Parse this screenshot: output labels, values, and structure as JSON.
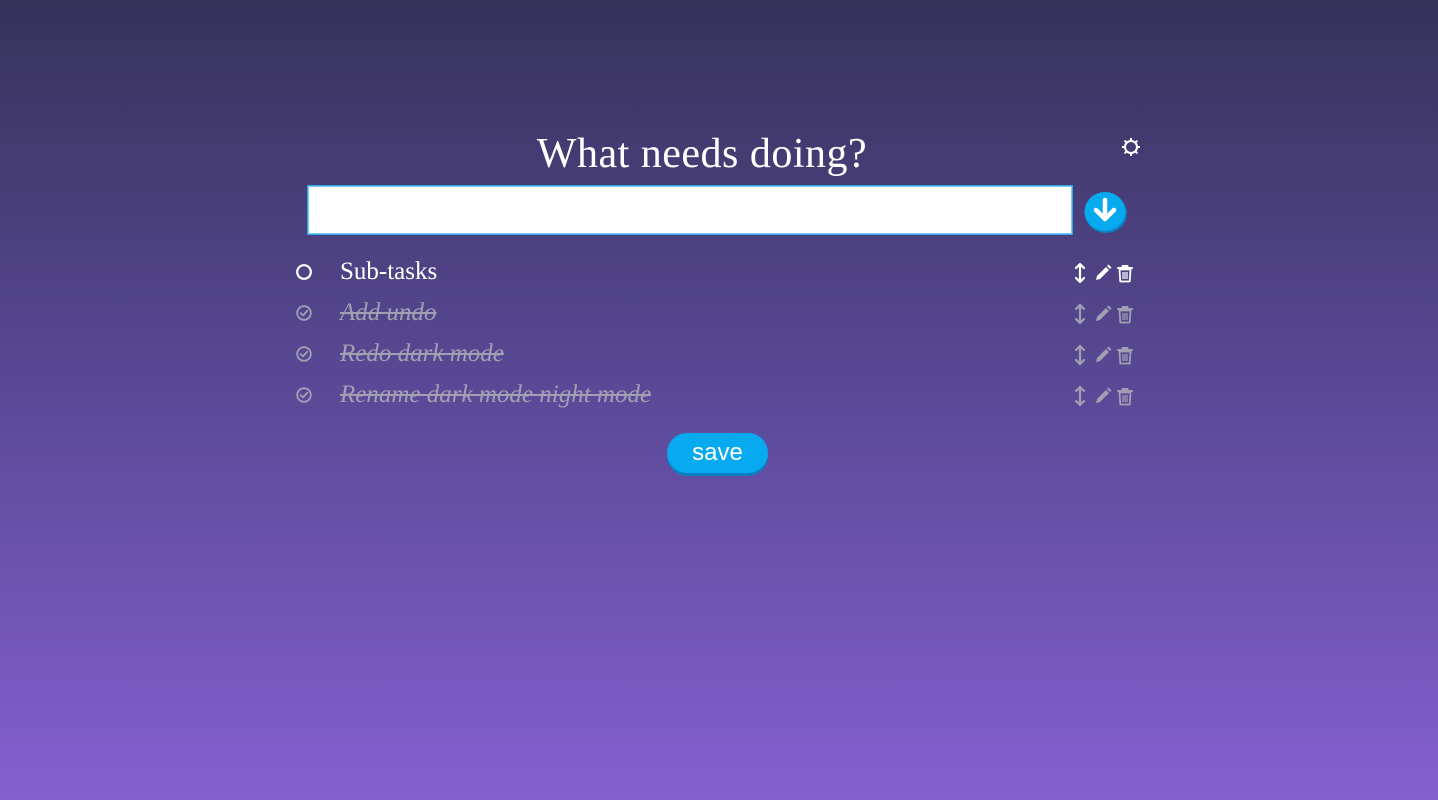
{
  "header": {
    "title": "What needs doing?",
    "settings_icon": "gear-icon"
  },
  "new_task": {
    "value": "",
    "placeholder": "",
    "add_icon": "arrow-down-circle-icon"
  },
  "tasks": [
    {
      "label": "Sub-tasks",
      "done": false
    },
    {
      "label": "Add undo",
      "done": true
    },
    {
      "label": "Redo dark mode",
      "done": true
    },
    {
      "label": "Rename dark mode night mode",
      "done": true
    }
  ],
  "task_actions": [
    "reorder-icon",
    "pencil-icon",
    "trash-icon"
  ],
  "footer": {
    "save_label": "save"
  },
  "colors": {
    "accent": "#07a9ef",
    "done_text": "#a39fb3",
    "background_top": "#36325a",
    "background_bottom": "#855fcf"
  }
}
